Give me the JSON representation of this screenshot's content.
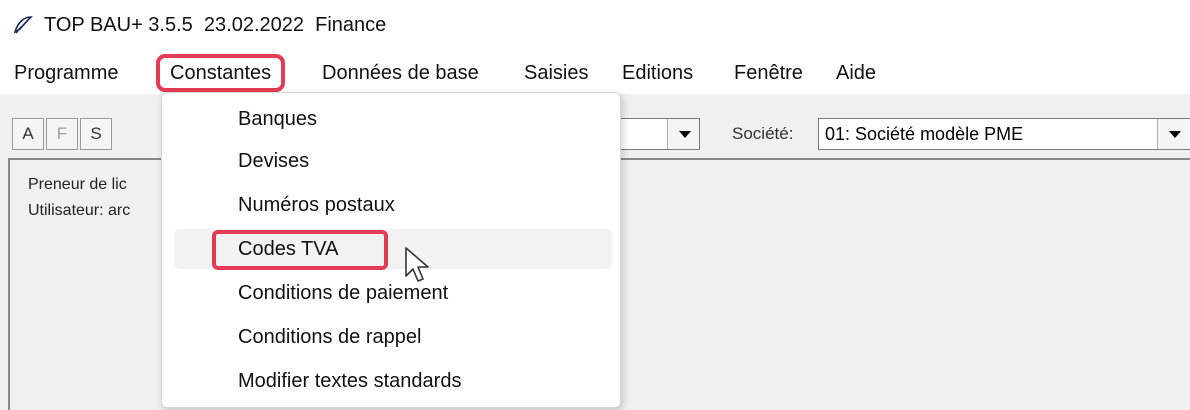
{
  "window": {
    "title": "TOP BAU+ 3.5.5  23.02.2022  Finance"
  },
  "menubar": {
    "items": [
      {
        "label": "Programme"
      },
      {
        "label": "Constantes"
      },
      {
        "label": "Données de base"
      },
      {
        "label": "Saisies"
      },
      {
        "label": "Editions"
      },
      {
        "label": "Fenêtre"
      },
      {
        "label": "Aide"
      }
    ]
  },
  "toolbar": {
    "buttons": [
      {
        "label": "A"
      },
      {
        "label": "F"
      },
      {
        "label": "S"
      }
    ],
    "societe_label": "Société:",
    "societe_value": "01: Société modèle PME"
  },
  "content": {
    "line1": "Preneur de lic",
    "line2": "Utilisateur: arc"
  },
  "dropdown": {
    "items": [
      {
        "label": "Banques"
      },
      {
        "label": "Devises"
      },
      {
        "label": "Numéros postaux"
      },
      {
        "label": "Codes TVA"
      },
      {
        "label": "Conditions de paiement"
      },
      {
        "label": "Conditions de rappel"
      },
      {
        "label": "Modifier textes standards"
      }
    ]
  },
  "colors": {
    "highlight": "#e23b53",
    "window_bg": "#f0f0f0"
  }
}
